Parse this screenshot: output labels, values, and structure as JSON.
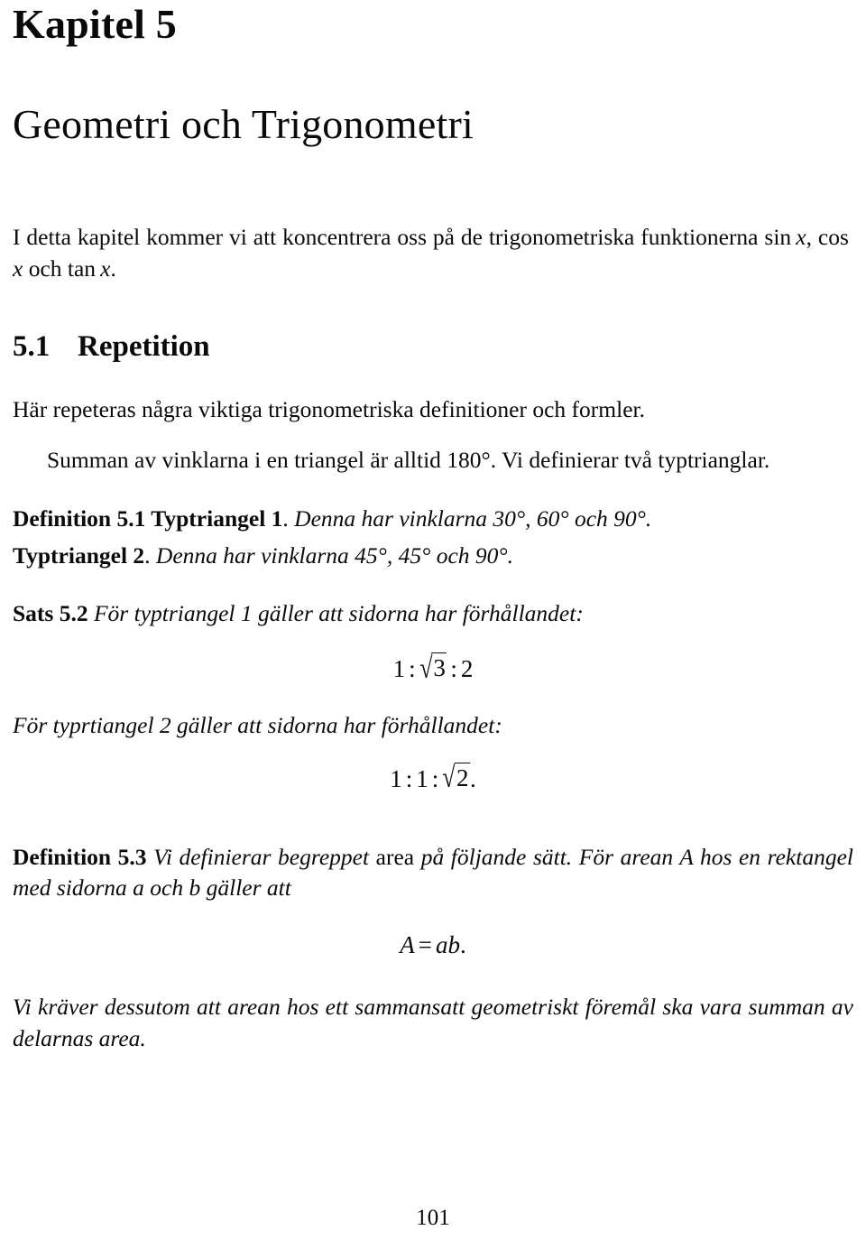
{
  "chapter": {
    "number_label": "Kapitel 5",
    "title": "Geometri och Trigonometri"
  },
  "intro": {
    "line_before_math": "I detta kapitel kommer vi att koncentrera oss på de trigonometriska funktionerna ",
    "fn_sin": "sin",
    "fn_sin_arg": "x",
    "comma": ", ",
    "fn_cos": "cos",
    "fn_cos_arg": "x",
    "conjunction": " och ",
    "fn_tan": "tan",
    "fn_tan_arg": "x",
    "period": "."
  },
  "section": {
    "number": "5.1",
    "title": "Repetition",
    "lead_paragraph": "Här repeteras några viktiga trigonometriska definitioner och formler.",
    "sum_paragraph": "Summan av vinklarna i en triangel är alltid 180°. Vi definierar två typtrianglar."
  },
  "definition_51": {
    "head": "Definition 5.1  Typtriangel 1",
    "head_period": ".",
    "body": " Denna har vinklarna 30°, 60° och 90°.",
    "second_head": "Typtriangel 2",
    "second_head_period": ".",
    "second_body": " Denna har vinklarna 45°, 45° och 90°."
  },
  "sats_52": {
    "head": "Sats 5.2",
    "body": " För typtriangel 1 gäller att sidorna har förhållandet:",
    "equation_1": {
      "first": "1",
      "sep1": ":",
      "radical_sign": "√",
      "radicand": "3",
      "sep2": ":",
      "last": "2"
    },
    "body_2": "För typrtiangel 2 gäller att sidorna har förhållandet:",
    "equation_2": {
      "first": "1",
      "sep1": ":",
      "second": "1",
      "sep2": ":",
      "radical_sign": "√",
      "radicand": "2",
      "trailing": "."
    }
  },
  "definition_53": {
    "head": "Definition 5.3",
    "body_part1": " Vi definierar begreppet ",
    "upright_term": "area",
    "body_part2": " på följande sätt. För arean A hos en rektangel med sidorna a och b gäller att",
    "equation": {
      "lhs": "A",
      "equals": "=",
      "rhs": "ab",
      "trailing": "."
    },
    "closing": "Vi kräver dessutom att arean hos ett sammansatt geometriskt föremål ska vara summan av delarnas area."
  },
  "folio": {
    "page_number": "101"
  }
}
